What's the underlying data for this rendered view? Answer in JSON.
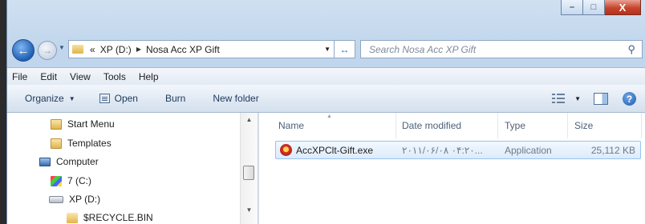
{
  "window": {
    "caption_minimize": "–",
    "caption_maximize": "□",
    "caption_close": "X"
  },
  "address": {
    "recent_arrow": "▼",
    "overflow": "«",
    "crumbs": [
      "XP (D:)",
      "Nosa Acc XP Gift"
    ],
    "separator": "▶",
    "dropdown": "▼",
    "refresh": "↔",
    "search_placeholder": "Search Nosa Acc XP Gift"
  },
  "menubar": [
    "File",
    "Edit",
    "View",
    "Tools",
    "Help"
  ],
  "commands": {
    "organize": "Organize",
    "open": "Open",
    "burn": "Burn",
    "new_folder": "New folder",
    "help": "?"
  },
  "nav": {
    "items": [
      {
        "label": "Start Menu",
        "icon": "folder-shortcut-icon"
      },
      {
        "label": "Templates",
        "icon": "folder-shortcut-icon"
      },
      {
        "label": "Computer",
        "icon": "computer-icon"
      },
      {
        "label": "7 (C:)",
        "icon": "windows-drive-icon"
      },
      {
        "label": "XP (D:)",
        "icon": "drive-icon"
      },
      {
        "label": "$RECYCLE.BIN",
        "icon": "folder-icon"
      }
    ]
  },
  "columns": {
    "name": "Name",
    "date": "Date modified",
    "type": "Type",
    "size": "Size"
  },
  "files": [
    {
      "name": "AccXPClt-Gift.exe",
      "date": "۲۰۱۱/۰۶/۰۸ ۰۴:۲۰...",
      "type": "Application",
      "size": "25,112 KB"
    }
  ]
}
